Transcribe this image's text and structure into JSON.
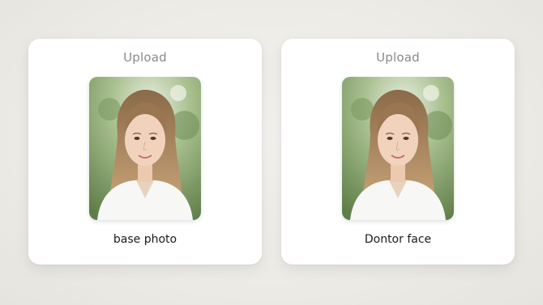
{
  "cards": [
    {
      "upload_label": "Upload",
      "photo_alt": "portrait-photo",
      "caption": "base photo"
    },
    {
      "upload_label": "Upload",
      "photo_alt": "portrait-photo",
      "caption": "Dontor face"
    }
  ],
  "colors": {
    "background": "#ecebe6",
    "card": "#ffffff",
    "upload_text": "#8a8a8a",
    "caption_text": "#1a1a1a"
  }
}
